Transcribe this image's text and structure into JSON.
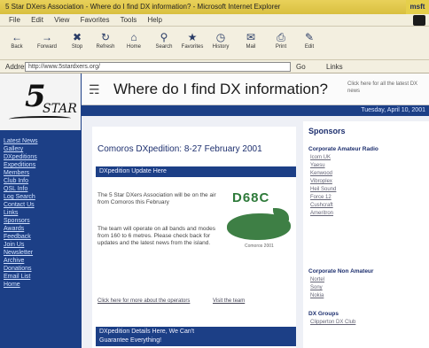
{
  "window": {
    "title": "5 Star DXers Association - Where do I find DX information? - Microsoft Internet Explorer",
    "brand": "msft"
  },
  "menubar": {
    "items": [
      "File",
      "Edit",
      "View",
      "Favorites",
      "Tools",
      "Help"
    ]
  },
  "toolbar": {
    "buttons": [
      {
        "name": "back-button",
        "label": "Back",
        "icon": "back-arrow-icon"
      },
      {
        "name": "forward-button",
        "label": "Forward",
        "icon": "forward-arrow-icon"
      },
      {
        "name": "stop-button",
        "label": "Stop",
        "icon": "stop-icon"
      },
      {
        "name": "refresh-button",
        "label": "Refresh",
        "icon": "refresh-icon"
      },
      {
        "name": "home-button",
        "label": "Home",
        "icon": "home-icon"
      },
      {
        "name": "search-button",
        "label": "Search",
        "icon": "search-icon"
      },
      {
        "name": "favorites-button",
        "label": "Favorites",
        "icon": "favorites-icon"
      },
      {
        "name": "history-button",
        "label": "History",
        "icon": "history-icon"
      },
      {
        "name": "mail-button",
        "label": "Mail",
        "icon": "mail-icon"
      },
      {
        "name": "print-button",
        "label": "Print",
        "icon": "print-icon"
      },
      {
        "name": "edit-button",
        "label": "Edit",
        "icon": "edit-icon"
      }
    ]
  },
  "addressbar": {
    "label": "Address",
    "value": "http://www.5stardxers.org/",
    "go": "Go",
    "links": "Links"
  },
  "nav": {
    "logo_main": "5",
    "logo_sub": "STAR",
    "links": [
      "Latest News",
      "Gallery",
      "DXpeditions",
      "Expeditions",
      "Members",
      "Club Info",
      "QSL Info",
      "Log Search",
      "Contact Us",
      "Links",
      "Sponsors",
      "Awards",
      "Feedback",
      "Join Us",
      "Newsletter",
      "Archive",
      "Donations",
      "Email List",
      "Home"
    ]
  },
  "banner": {
    "icon": "antenna-icon",
    "title": "Where do I find DX information?",
    "note": "Click here for all the latest DX news"
  },
  "datebar": {
    "date": "Tuesday, April 10, 2001"
  },
  "main": {
    "headline": "Comoros DXpedition: 8-27 February 2001",
    "subheading": "DXpedition Update Here",
    "para1": "The 5 Star DXers Association will be on the air from Comoros this February",
    "para2": "The team will operate on all bands and modes from 160 to 6 metres. Please check back for updates and the latest news from the island.",
    "logo_code": "D68C",
    "logo_tag": "Comoros 2001",
    "footer_link1": "Click here for more about the operators",
    "footer_link2": "Visit the team",
    "bottom_title": "DXpedition Details Here, We Can't",
    "bottom_sub": "Guarantee Everything!"
  },
  "sponsors": {
    "title": "Sponsors",
    "groups": [
      {
        "heading": "Corporate Amateur Radio",
        "items": [
          "Icom UK",
          "Yaesu",
          "Kenwood",
          "Vibroplex",
          "Heil Sound",
          "Force 12",
          "Cushcraft",
          "Ameritron"
        ]
      },
      {
        "heading": "Corporate Non Amateur",
        "items": [
          "Nortel",
          "Sony",
          "Nokia"
        ]
      },
      {
        "heading": "DX Groups",
        "items": [
          "Clipperton DX Club"
        ]
      }
    ]
  }
}
